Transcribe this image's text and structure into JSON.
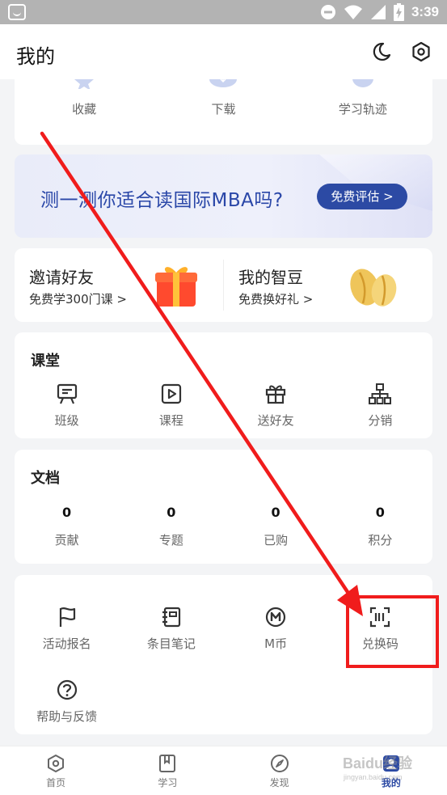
{
  "status_bar": {
    "time": "3:39"
  },
  "header": {
    "title": "我的"
  },
  "quick_actions": [
    {
      "label": "收藏"
    },
    {
      "label": "下载"
    },
    {
      "label": "学习轨迹"
    }
  ],
  "banner": {
    "text": "测一测你适合读国际MBA吗?",
    "button": "免费评估 >"
  },
  "promo": {
    "invite": {
      "title": "邀请好友",
      "sub": "免费学300门课 >"
    },
    "beans": {
      "title": "我的智豆",
      "sub": "免费换好礼 >"
    }
  },
  "classroom": {
    "title": "课堂",
    "items": [
      {
        "label": "班级",
        "icon": "chat-board-icon"
      },
      {
        "label": "课程",
        "icon": "play-icon"
      },
      {
        "label": "送好友",
        "icon": "gift-icon"
      },
      {
        "label": "分销",
        "icon": "hierarchy-icon"
      }
    ]
  },
  "documents": {
    "title": "文档",
    "items": [
      {
        "count": "0",
        "label": "贡献"
      },
      {
        "count": "0",
        "label": "专题"
      },
      {
        "count": "0",
        "label": "已购"
      },
      {
        "count": "0",
        "label": "积分"
      }
    ]
  },
  "tools": {
    "items": [
      {
        "label": "活动报名",
        "icon": "flag-icon"
      },
      {
        "label": "条目笔记",
        "icon": "notebook-icon"
      },
      {
        "label": "M币",
        "icon": "m-coin-icon"
      },
      {
        "label": "兑换码",
        "icon": "scan-code-icon"
      },
      {
        "label": "帮助与反馈",
        "icon": "help-icon"
      }
    ]
  },
  "tabbar": {
    "tabs": [
      {
        "label": "首页"
      },
      {
        "label": "学习"
      },
      {
        "label": "发现"
      },
      {
        "label": "我的"
      }
    ]
  },
  "watermark": {
    "text": "Baidu经验",
    "sub": "jingyan.baidu.com"
  },
  "colors": {
    "accent": "#2c4aa4",
    "annotation": "#f01c1c",
    "background": "#f3f4f6"
  }
}
